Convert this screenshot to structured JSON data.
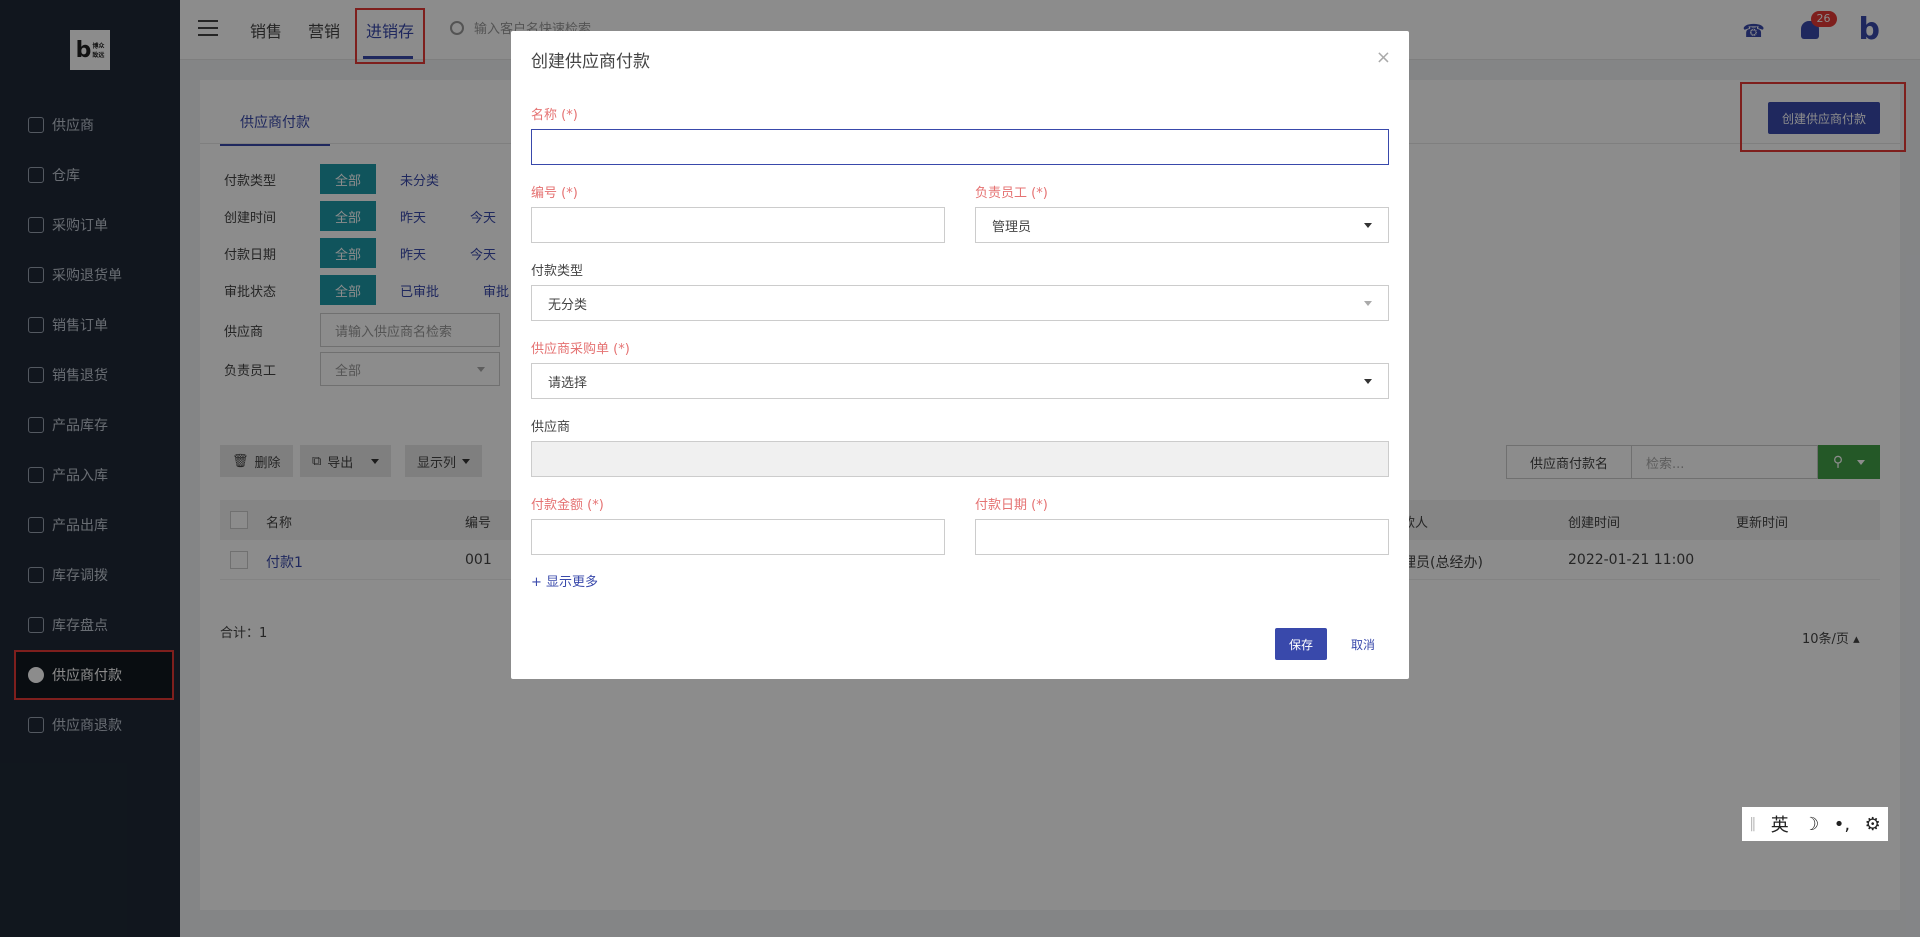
{
  "logo": {
    "mark": "b",
    "text": "博众\n致远"
  },
  "sidebar": {
    "items": [
      {
        "label": "供应商"
      },
      {
        "label": "仓库"
      },
      {
        "label": "采购订单"
      },
      {
        "label": "采购退货单"
      },
      {
        "label": "销售订单"
      },
      {
        "label": "销售退货"
      },
      {
        "label": "产品库存"
      },
      {
        "label": "产品入库"
      },
      {
        "label": "产品出库"
      },
      {
        "label": "库存调拨"
      },
      {
        "label": "库存盘点"
      },
      {
        "label": "供应商付款"
      },
      {
        "label": "供应商退款"
      }
    ],
    "active": "供应商付款"
  },
  "topnav": {
    "items": [
      "销售",
      "营销",
      "进销存"
    ],
    "active": "进销存",
    "search_placeholder": "输入客户名快速检索",
    "notif_count": "26"
  },
  "page": {
    "tab": "供应商付款",
    "create_button": "创建供应商付款",
    "filters": {
      "payment_type": {
        "label": "付款类型",
        "all": "全部",
        "opts": [
          "未分类"
        ]
      },
      "created": {
        "label": "创建时间",
        "all": "全部",
        "opts": [
          "昨天",
          "今天"
        ]
      },
      "pay_date": {
        "label": "付款日期",
        "all": "全部",
        "opts": [
          "昨天",
          "今天"
        ]
      },
      "approval": {
        "label": "审批状态",
        "all": "全部",
        "opts": [
          "已审批",
          "审批"
        ]
      },
      "supplier": {
        "label": "供应商",
        "placeholder": "请输入供应商名检索"
      },
      "owner": {
        "label": "负责员工",
        "value": "全部"
      }
    },
    "toolbar": {
      "delete": "删除",
      "export": "导出",
      "columns": "显示列"
    },
    "search": {
      "select": "供应商付款名",
      "placeholder": "检索..."
    },
    "table": {
      "headers": {
        "name": "名称",
        "code": "编号",
        "payer": "款人",
        "created": "创建时间",
        "updated": "更新时间"
      },
      "rows": [
        {
          "name": "付款1",
          "code": "001",
          "payer": "理员(总经办)",
          "created": "2022-01-21 11:00",
          "updated": ""
        }
      ]
    },
    "total": "合计：1",
    "pager": "10条/页"
  },
  "modal": {
    "title": "创建供应商付款",
    "close": "×",
    "name": {
      "label": "名称 (*)",
      "value": ""
    },
    "code": {
      "label": "编号 (*)",
      "value": ""
    },
    "owner": {
      "label": "负责员工 (*)",
      "value": "管理员"
    },
    "pay_type": {
      "label": "付款类型",
      "value": "无分类"
    },
    "po": {
      "label": "供应商采购单 (*)",
      "value": "请选择"
    },
    "supplier": {
      "label": "供应商",
      "value": ""
    },
    "amount": {
      "label": "付款金额 (*)",
      "value": ""
    },
    "date": {
      "label": "付款日期 (*)",
      "value": ""
    },
    "more": "+ 显示更多",
    "save": "保存",
    "cancel": "取消"
  },
  "ime": {
    "lang": "英"
  },
  "colors": {
    "primary": "#3949ab",
    "teal": "#1e9aa8",
    "green": "#43a047",
    "highlight": "#e53935",
    "sidebar": "#1f2937"
  }
}
